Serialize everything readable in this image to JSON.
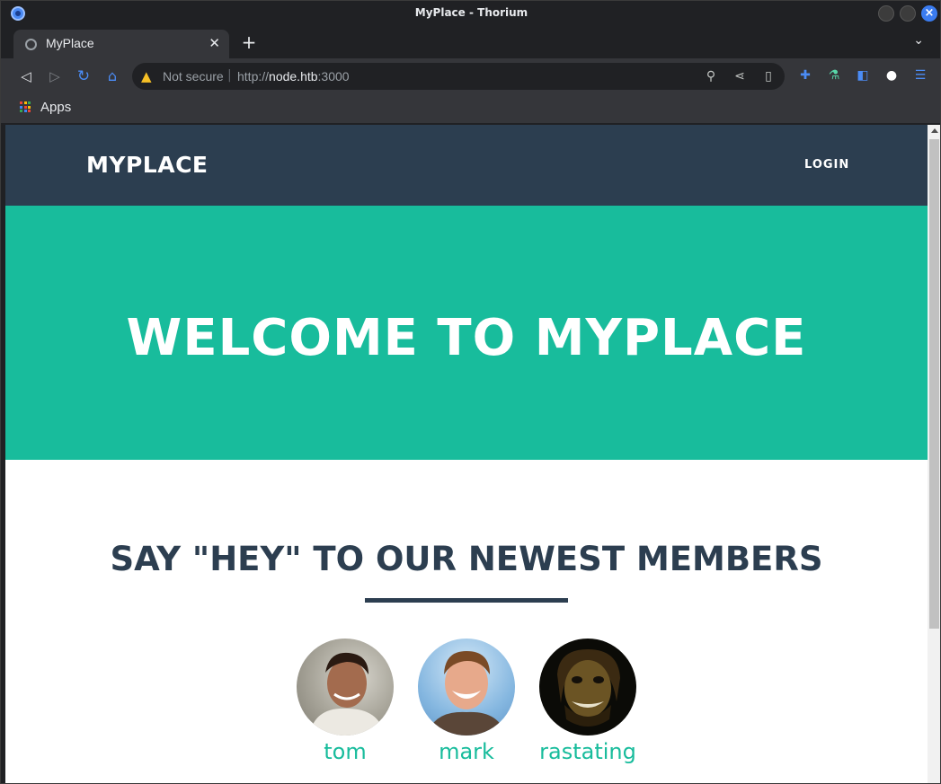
{
  "window": {
    "title": "MyPlace - Thorium"
  },
  "tabs": [
    {
      "title": "MyPlace"
    }
  ],
  "toolbar": {
    "security_label": "Not secure",
    "url_scheme": "http://",
    "url_host": "node.htb",
    "url_port": ":3000"
  },
  "bookmarks": {
    "apps_label": "Apps"
  },
  "site": {
    "brand": "MYPLACE",
    "nav_login": "LOGIN",
    "hero_title": "WELCOME TO MYPLACE",
    "members_title": "SAY \"HEY\" TO OUR NEWEST MEMBERS",
    "members": [
      {
        "name": "tom"
      },
      {
        "name": "mark"
      },
      {
        "name": "rastating"
      }
    ]
  },
  "colors": {
    "navbar": "#2c3e50",
    "hero": "#18bc9c",
    "accent": "#18bc9c",
    "heading": "#2c3e50"
  }
}
